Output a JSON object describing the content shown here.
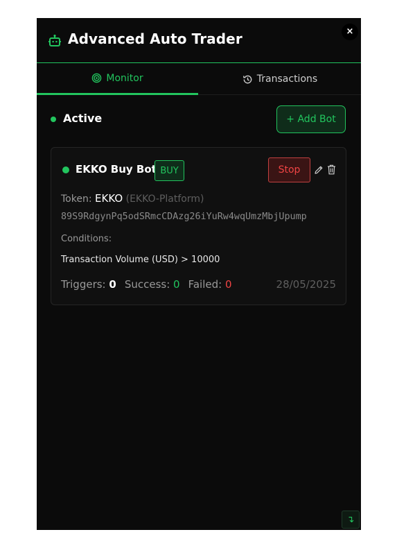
{
  "header": {
    "title": "Advanced Auto Trader",
    "icon": "robot-icon",
    "close_glyph": "×"
  },
  "tabs": [
    {
      "label": "Monitor",
      "icon": "target-icon",
      "active": true
    },
    {
      "label": "Transactions",
      "icon": "history-icon",
      "active": false
    }
  ],
  "status": {
    "label": "Active"
  },
  "add_bot": {
    "label": "+ Add Bot"
  },
  "bot": {
    "name": "EKKO Buy Bot",
    "side": "BUY",
    "stop_label": "Stop",
    "token_label": "Token:",
    "token_symbol": "EKKO",
    "token_platform": "(EKKO-Platform)",
    "address": "89S9RdgynPq5odSRmcCDAzg26iYuRw4wqUmzMbjUpump",
    "conditions_label": "Conditions:",
    "condition": "Transaction Volume (USD) > 10000",
    "triggers_label": "Triggers:",
    "triggers": "0",
    "success_label": "Success:",
    "success": "0",
    "failed_label": "Failed:",
    "failed": "0",
    "date": "28/05/2025"
  },
  "corner": {
    "glyph": "↴"
  },
  "colors": {
    "accent": "#22c55e",
    "danger": "#ef4444",
    "background": "#0b0b0b"
  }
}
